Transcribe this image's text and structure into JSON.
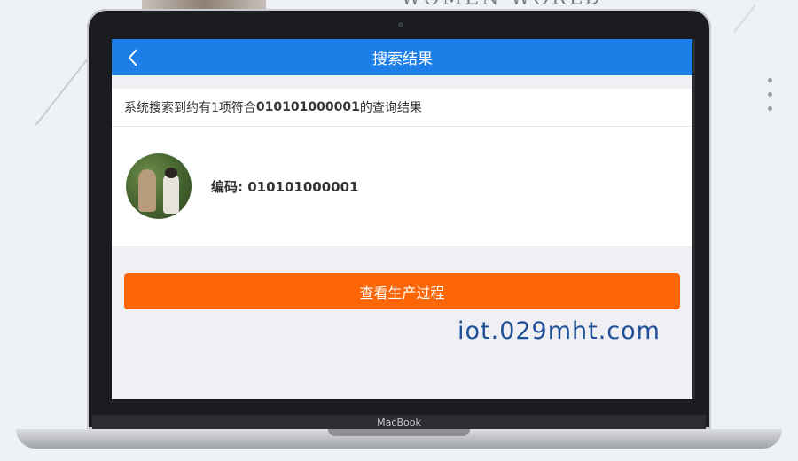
{
  "background": {
    "text": "WOMEN WORLD"
  },
  "device": {
    "brand_label": "MacBook"
  },
  "header": {
    "title": "搜索结果",
    "back_icon": "chevron-left-icon",
    "color": "#1e7ee8"
  },
  "summary": {
    "prefix": "系统搜索到约有1项符合",
    "query": "010101000001",
    "suffix": "的查询结果"
  },
  "result": {
    "avatar": "farm-photo-avatar",
    "code_label": "编码: 010101000001"
  },
  "action": {
    "label": "查看生产过程",
    "color": "#fd6606"
  },
  "watermark": {
    "text": "iot.029mht.com"
  }
}
